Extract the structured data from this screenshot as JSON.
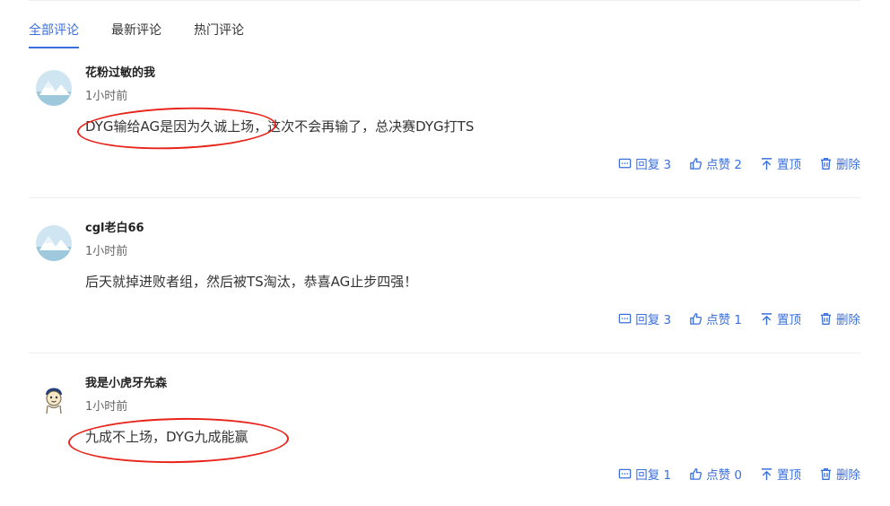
{
  "tabs": [
    {
      "label": "全部评论",
      "active": true
    },
    {
      "label": "最新评论",
      "active": false
    },
    {
      "label": "热门评论",
      "active": false
    }
  ],
  "comments": [
    {
      "username": "花粉过敏的我",
      "time": "1小时前",
      "text": "DYG输给AG是因为久诚上场，这次不会再输了，总决赛DYG打TS",
      "reply_label": "回复 3",
      "like_label": "点赞 2",
      "pin_label": "置顶",
      "delete_label": "删除",
      "avatar_icon": "snow-mountain-avatar"
    },
    {
      "username": "cgl老白66",
      "time": "1小时前",
      "text": "后天就掉进败者组，然后被TS淘汰，恭喜AG止步四强！",
      "reply_label": "回复 3",
      "like_label": "点赞 1",
      "pin_label": "置顶",
      "delete_label": "删除",
      "avatar_icon": "snow-mountain-avatar"
    },
    {
      "username": "我是小虎牙先森",
      "time": "1小时前",
      "text": "九成不上场，DYG九成能赢",
      "reply_label": "回复 1",
      "like_label": "点赞 0",
      "pin_label": "置顶",
      "delete_label": "删除",
      "avatar_icon": "cartoon-character-avatar"
    }
  ],
  "colors": {
    "accent": "#3b6fdb",
    "annotation": "#e8231a"
  }
}
